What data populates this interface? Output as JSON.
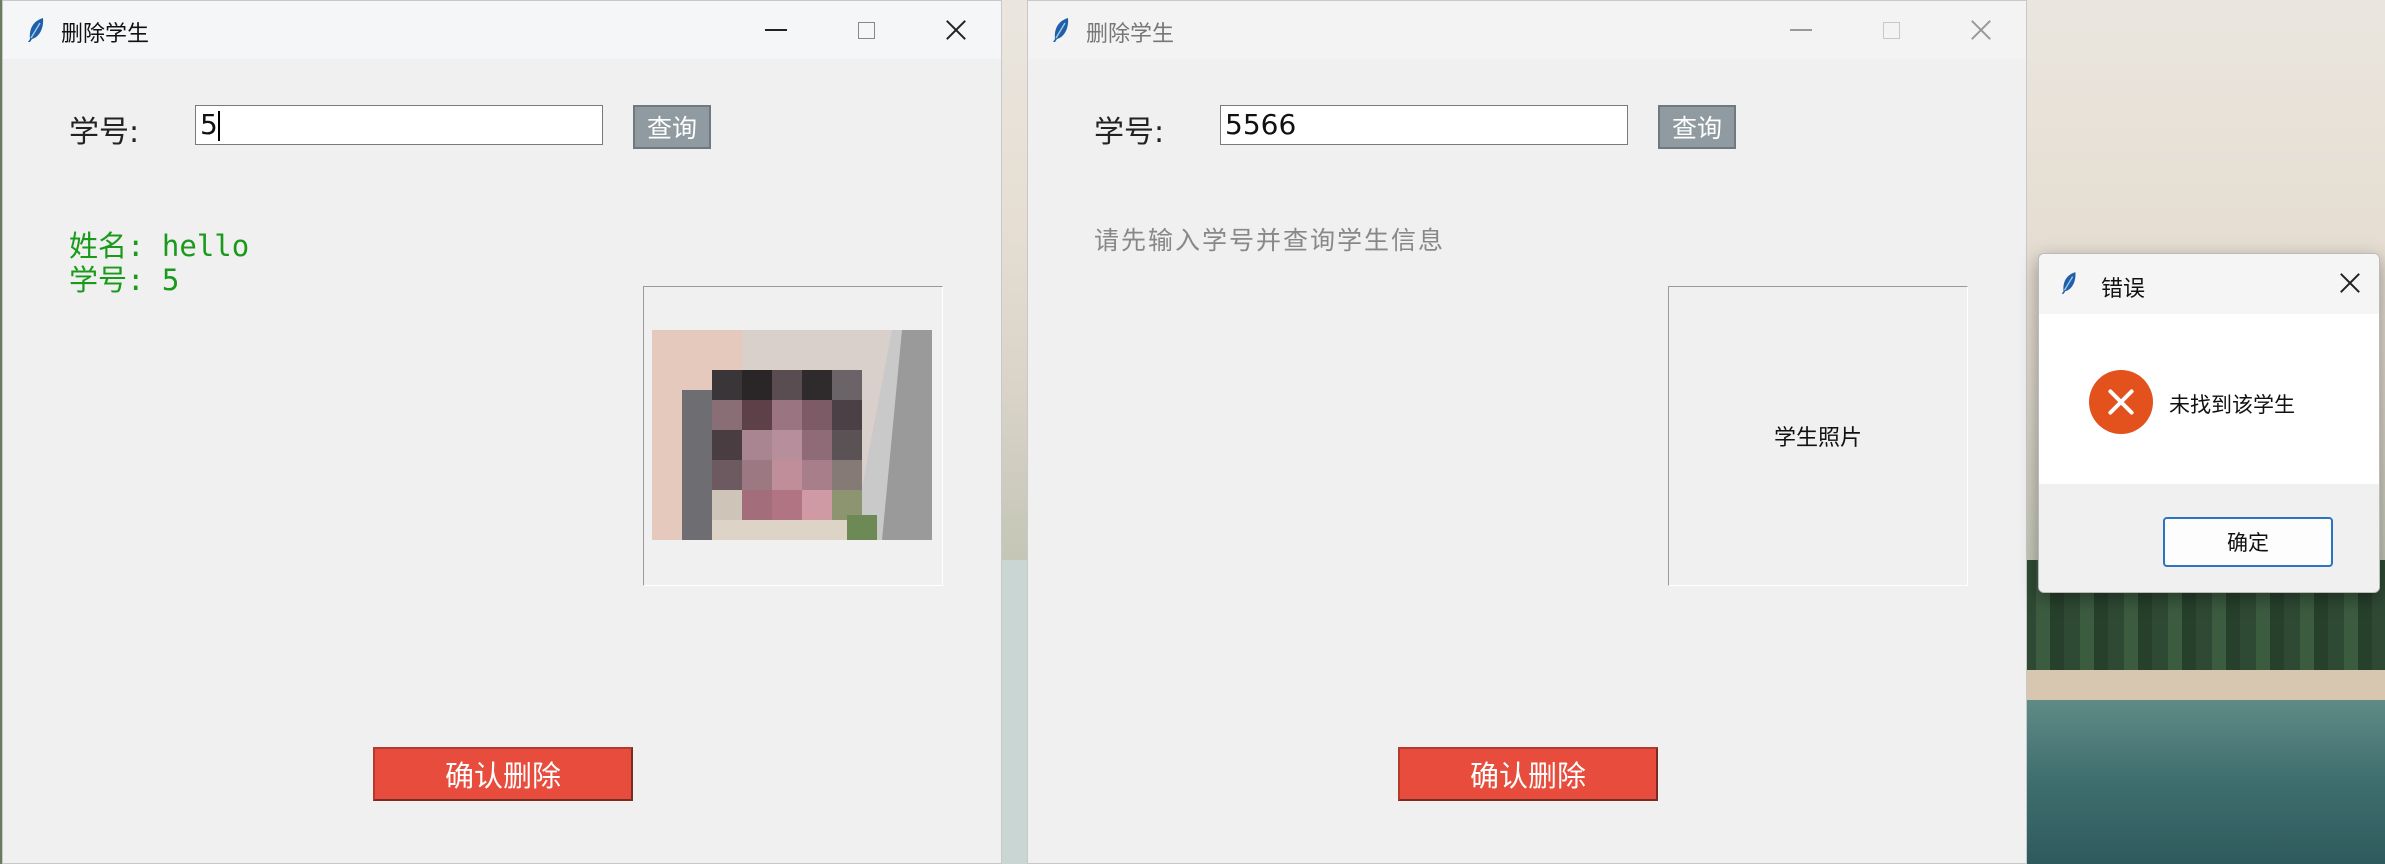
{
  "window_left": {
    "title": "删除学生",
    "student_id_label": "学号:",
    "student_id_value": "5",
    "query_button": "查询",
    "info_name": "姓名: hello",
    "info_id": "学号: 5",
    "delete_button": "确认删除"
  },
  "window_right": {
    "title": "删除学生",
    "student_id_label": "学号:",
    "student_id_value": "5566",
    "query_button": "查询",
    "hint": "请先输入学号并查询学生信息",
    "photo_placeholder": "学生照片",
    "delete_button": "确认删除"
  },
  "error_dialog": {
    "title": "错误",
    "message": "未找到该学生",
    "ok_button": "确定",
    "icon": "error-icon"
  },
  "colors": {
    "accent_delete": "#e74c3c",
    "info_green": "#1a9a1a",
    "error_icon": "#e3511d",
    "ok_border": "#2b74c2"
  }
}
